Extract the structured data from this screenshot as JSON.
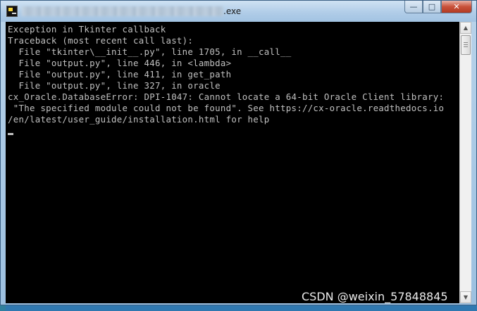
{
  "window": {
    "title_suffix": ".exe",
    "controls": {
      "minimize_glyph": "—",
      "maximize_glyph": "□",
      "close_glyph": "✕"
    }
  },
  "console": {
    "lines": [
      "Exception in Tkinter callback",
      "Traceback (most recent call last):",
      "  File \"tkinter\\__init__.py\", line 1705, in __call__",
      "  File \"output.py\", line 446, in <lambda>",
      "  File \"output.py\", line 411, in get_path",
      "  File \"output.py\", line 327, in oracle",
      "cx_Oracle.DatabaseError: DPI-1047: Cannot locate a 64-bit Oracle Client library:",
      " \"The specified module could not be found\". See https://cx-oracle.readthedocs.io",
      "/en/latest/user_guide/installation.html for help"
    ]
  },
  "scrollbar": {
    "up_glyph": "▲",
    "down_glyph": "▼"
  },
  "watermark": {
    "text": "CSDN @weixin_57848845"
  },
  "colors": {
    "console_bg": "#000000",
    "console_text": "#c0c0c0",
    "titlebar": "#b1cde8",
    "close_button": "#c8513a"
  },
  "icons": {
    "app": "console-app-icon"
  }
}
